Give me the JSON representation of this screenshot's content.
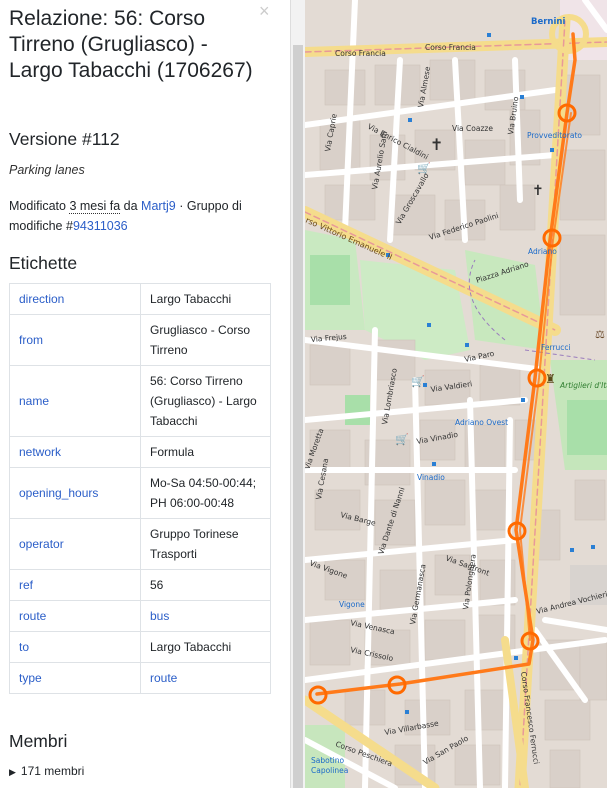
{
  "sidebar": {
    "title": "Relazione: 56: Corso Tirreno (Grugliasco) - Largo Tabacchi (1706267)",
    "close_icon": "close-icon",
    "version": "Versione #112",
    "comment": "Parking lanes",
    "meta": {
      "prefix": "Modificato ",
      "time": "3 mesi fa",
      "by": " da ",
      "user": "Martj9",
      "changeset_label": " · Gruppo di modifiche #",
      "changeset": "94311036"
    },
    "tags_heading": "Etichette",
    "tags": [
      {
        "key": "direction",
        "value": "Largo Tabacchi",
        "value_link": false
      },
      {
        "key": "from",
        "value": "Grugliasco - Corso Tirreno",
        "value_link": false
      },
      {
        "key": "name",
        "value": "56: Corso Tirreno (Grugliasco) - Largo Tabacchi",
        "value_link": false
      },
      {
        "key": "network",
        "value": "Formula",
        "value_link": false
      },
      {
        "key": "opening_hours",
        "value": "Mo-Sa 04:50-00:44; PH 06:00-00:48",
        "value_link": false
      },
      {
        "key": "operator",
        "value": "Gruppo Torinese Trasporti",
        "value_link": false
      },
      {
        "key": "ref",
        "value": "56",
        "value_link": false
      },
      {
        "key": "route",
        "value": "bus",
        "value_link": true
      },
      {
        "key": "to",
        "value": "Largo Tabacchi",
        "value_link": false
      },
      {
        "key": "type",
        "value": "route",
        "value_link": true
      }
    ],
    "members_heading": "Membri",
    "members_toggle": "171 membri"
  },
  "map": {
    "labels": {
      "corso_francia_1": "Corso Francia",
      "corso_francia_2": "Corso Francia",
      "bernini": "Bernini",
      "via_coazze": "Via Coazze",
      "provveditorato": "Provveditorato",
      "via_cialdini": "Via Enrico Cialdini",
      "corso_vittorio": "rso Vittorio Emanuele II",
      "via_paolini": "Via Federico Paolini",
      "adriano": "Adriano",
      "piazza_adriano": "Piazza Adriano",
      "via_frejus": "Via Frejus",
      "ferrucci": "Ferrucci",
      "artiglieri": "Artiglieri d'Italia",
      "via_valdieri": "Via Valdieri",
      "adriano_ovest": "Adriano Ovest",
      "via_vinadio": "Via Vinadio",
      "vinadio": "Vinadio",
      "via_moretta": "Via Moretta",
      "via_dante": "Via Dante di Nanni",
      "via_barge": "Via Barge",
      "via_sanfront": "Via Sanfront",
      "via_vigone": "Via Vigone",
      "vigone": "Vigone",
      "via_venasca": "Via Venasca",
      "via_crissolo": "Via Crissolo",
      "via_germanasca": "Via Germanasca",
      "via_polonghera": "Via Polonghera",
      "corso_ferrucci": "Corso Francesco Ferrucci",
      "via_vochieri": "Via Andrea Vochieri",
      "via_villarbasse": "Via Villarbasse",
      "via_san_paolo": "Via San Paolo",
      "corso_peschiera": "Corso Peschiera",
      "sabotino": "Sabotino",
      "capolinea": "Capolinea",
      "via_aurelio_saffi": "Via Aurelio Saffi",
      "via_grosseto": "Via Groscavallo",
      "via_bruino": "Via Bruino",
      "via_capriè": "Via Caprie",
      "via_lombriasco": "Via Lombriasco",
      "via_cesana": "Via Cesana",
      "via_almese": "Via Almese",
      "via_parma": "Via Paro"
    },
    "route_color": "#ff7a1a",
    "tram_color": "#f3a58f"
  }
}
